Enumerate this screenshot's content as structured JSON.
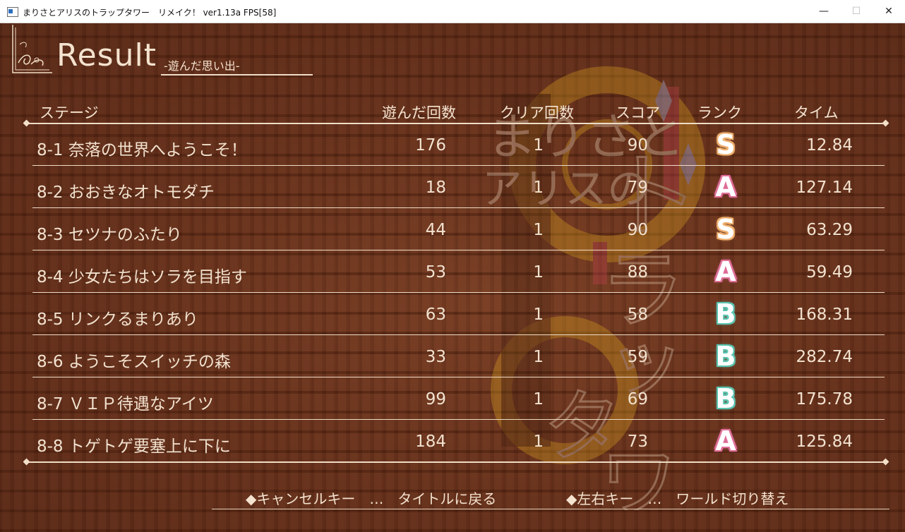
{
  "window": {
    "title": "まりさとアリスのトラップタワー　リメイク！ ver1.13a FPS[58]",
    "controls": {
      "minimize": "—",
      "maximize": "☐",
      "close": "✕"
    }
  },
  "screen": {
    "title": "Result",
    "subtitle": "-遊んだ思い出-"
  },
  "table": {
    "headers": {
      "stage": "ステージ",
      "plays": "遊んだ回数",
      "clears": "クリア回数",
      "score": "スコア",
      "rank": "ランク",
      "time": "タイム"
    },
    "rows": [
      {
        "stage": "8-1 奈落の世界へようこそ！",
        "plays": "176",
        "clears": "1",
        "score": "90",
        "rank": "S",
        "time": "12.84"
      },
      {
        "stage": "8-2 おおきなオトモダチ",
        "plays": "18",
        "clears": "1",
        "score": "79",
        "rank": "A",
        "time": "127.14"
      },
      {
        "stage": "8-3 セツナのふたり",
        "plays": "44",
        "clears": "1",
        "score": "90",
        "rank": "S",
        "time": "63.29"
      },
      {
        "stage": "8-4 少女たちはソラを目指す",
        "plays": "53",
        "clears": "1",
        "score": "88",
        "rank": "A",
        "time": "59.49"
      },
      {
        "stage": "8-5 リンクるまりあり",
        "plays": "63",
        "clears": "1",
        "score": "58",
        "rank": "B",
        "time": "168.31"
      },
      {
        "stage": "8-6 ようこそスイッチの森",
        "plays": "33",
        "clears": "1",
        "score": "59",
        "rank": "B",
        "time": "282.74"
      },
      {
        "stage": "8-7 ＶＩＰ待遇なアイツ",
        "plays": "99",
        "clears": "1",
        "score": "69",
        "rank": "B",
        "time": "175.78"
      },
      {
        "stage": "8-8 トゲトゲ要塞上に下に",
        "plays": "184",
        "clears": "1",
        "score": "73",
        "rank": "A",
        "time": "125.84"
      }
    ]
  },
  "footer": {
    "cancel": "◆キャンセルキー　…　タイトルに戻る",
    "switch": "◆左右キー　…　ワールド切り替え"
  },
  "colors": {
    "text": "#f4e3cf",
    "rank_S": "#f0b070",
    "rank_A": "#e0709a",
    "rank_B": "#5cc4b0"
  }
}
